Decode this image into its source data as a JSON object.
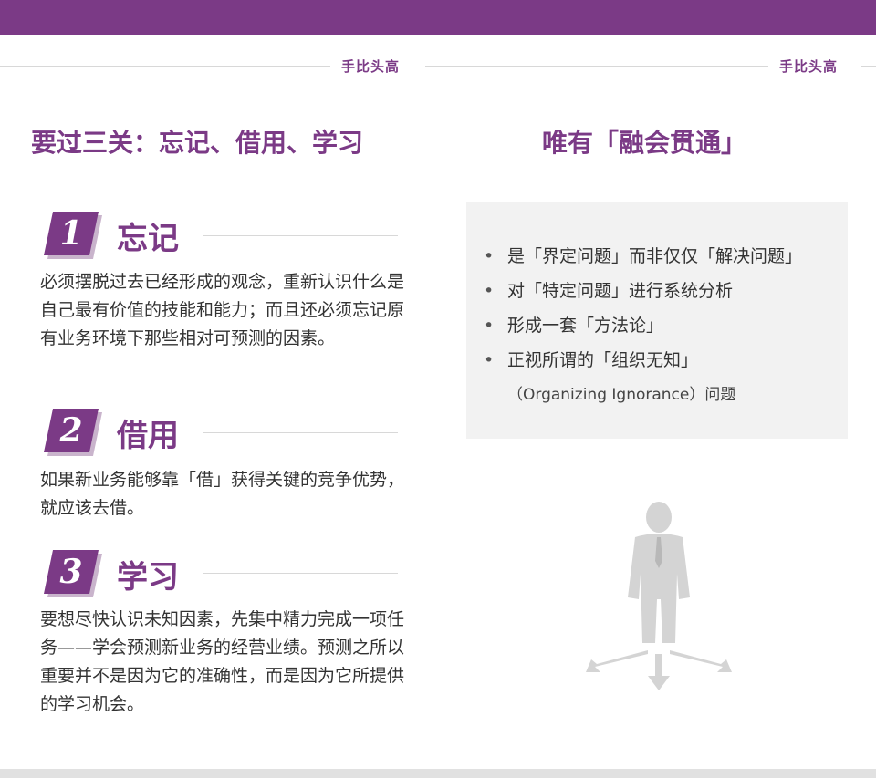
{
  "header": {
    "brand_left": "手比头高",
    "brand_right": "手比头高"
  },
  "left": {
    "title": "要过三关：忘记、借用、学习",
    "steps": [
      {
        "number": "1",
        "title": "忘记",
        "body": "必须摆脱过去已经形成的观念，重新认识什么是自己最有价值的技能和能力；而且还必须忘记原有业务环境下那些相对可预测的因素。"
      },
      {
        "number": "2",
        "title": "借用",
        "body": "如果新业务能够靠「借」获得关键的竞争优势，就应该去借。"
      },
      {
        "number": "3",
        "title": "学习",
        "body": "要想尽快认识未知因素，先集中精力完成一项任务——学会预测新业务的经营业绩。预测之所以重要并不是因为它的准确性，而是因为它所提供的学习机会。"
      }
    ]
  },
  "right": {
    "title": "唯有「融会贯通」",
    "bullets": [
      "是「界定问题」而非仅仅「解决问题」",
      "对「特定问题」进行系统分析",
      "形成一套「方法论」",
      "正视所谓的「组织无知」"
    ],
    "bullet_sub": "（Organizing Ignorance）问题",
    "bullet_marker": "•"
  },
  "colors": {
    "accent": "#7b3a86",
    "panel": "#f2f2f2",
    "figure": "#d4d4d4"
  },
  "icons": {
    "figure": "businessman-crossroads-icon"
  }
}
